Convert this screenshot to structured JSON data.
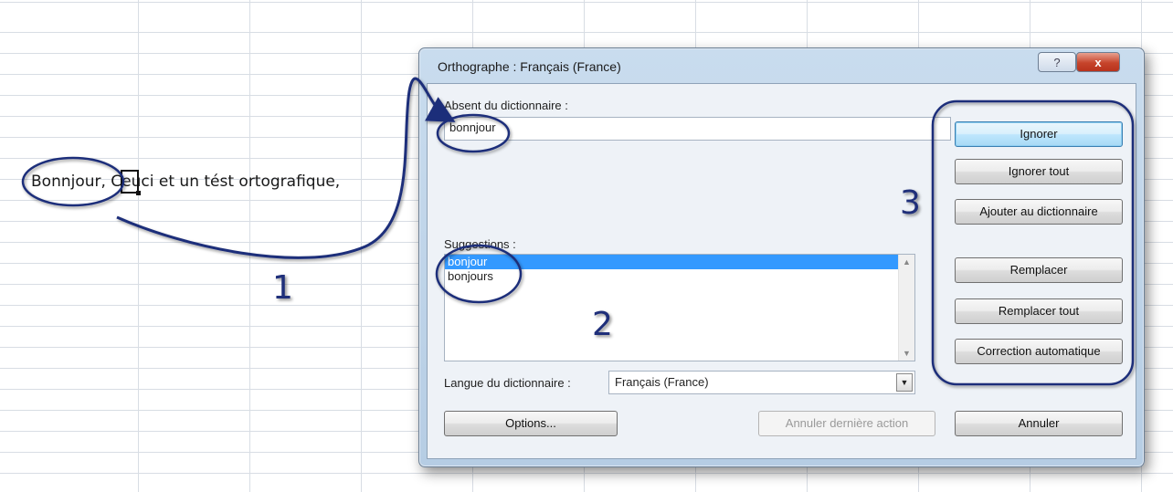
{
  "spreadsheet": {
    "cell_text": "Bonnjour, Ceuci et un tést ortografique,"
  },
  "annotations": {
    "num1": "1",
    "num2": "2",
    "num3": "3",
    "color": "#1f2f7a"
  },
  "dialog": {
    "title": "Orthographe : Français (France)",
    "help_label": "?",
    "close_label": "x",
    "not_in_dict_label": "Absent du dictionnaire :",
    "not_in_dict_value": "bonnjour",
    "suggestions_label": "Suggestions :",
    "suggestions": [
      "bonjour",
      "bonjours"
    ],
    "selected_suggestion": "bonjour",
    "dict_lang_label": "Langue du dictionnaire :",
    "dict_lang_value": "Français (France)",
    "buttons": {
      "ignore": "Ignorer",
      "ignore_all": "Ignorer tout",
      "add_to_dict": "Ajouter au dictionnaire",
      "replace": "Remplacer",
      "replace_all": "Remplacer tout",
      "autocorrect": "Correction automatique",
      "options": "Options...",
      "undo_last": "Annuler dernière action",
      "cancel": "Annuler"
    }
  }
}
